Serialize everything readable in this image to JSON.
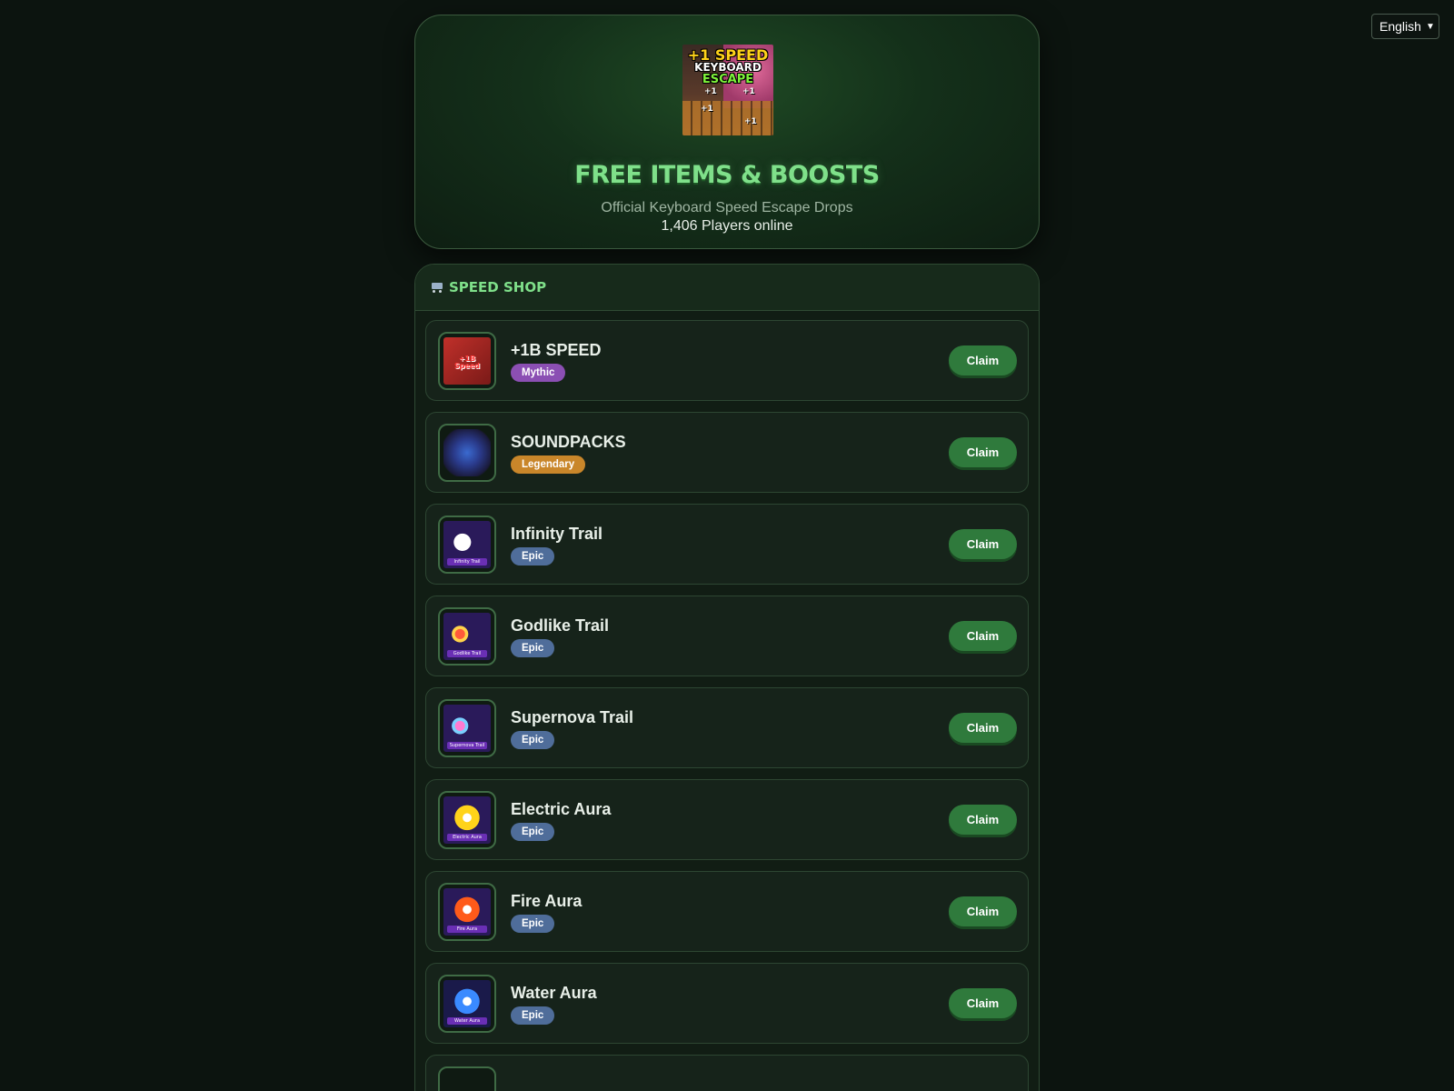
{
  "language": {
    "selected": "English"
  },
  "header": {
    "thumbnail": {
      "line1": "+1 SPEED",
      "line2": "KEYBOARD",
      "line3": "ESCAPE",
      "badge": "+1"
    },
    "title": "FREE ITEMS & BOOSTS",
    "subtitle": "Official Keyboard Speed Escape Drops",
    "online": "1,406 Players online"
  },
  "shop": {
    "title": "SPEED SHOP",
    "icon": "cart-icon",
    "items": [
      {
        "name": "+1B SPEED",
        "rarity": "Mythic",
        "rarity_color": "#8b4fb3",
        "icon": "red-shoe-speed-icon",
        "icon_label": "+1B Speed",
        "claim": "Claim"
      },
      {
        "name": "SOUNDPACKS",
        "rarity": "Legendary",
        "rarity_color": "#c9862a",
        "icon": "soundpacks-orb-icon",
        "icon_label": "",
        "claim": "Claim"
      },
      {
        "name": "Infinity Trail",
        "rarity": "Epic",
        "rarity_color": "#4f6d9a",
        "icon": "infinity-trail-icon",
        "icon_label": "Infinity Trail",
        "claim": "Claim"
      },
      {
        "name": "Godlike Trail",
        "rarity": "Epic",
        "rarity_color": "#4f6d9a",
        "icon": "godlike-trail-icon",
        "icon_label": "Godlike Trail",
        "claim": "Claim"
      },
      {
        "name": "Supernova Trail",
        "rarity": "Epic",
        "rarity_color": "#4f6d9a",
        "icon": "supernova-trail-icon",
        "icon_label": "Supernova Trail",
        "claim": "Claim"
      },
      {
        "name": "Electric Aura",
        "rarity": "Epic",
        "rarity_color": "#4f6d9a",
        "icon": "electric-aura-icon",
        "icon_label": "Electric Aura",
        "claim": "Claim"
      },
      {
        "name": "Fire Aura",
        "rarity": "Epic",
        "rarity_color": "#4f6d9a",
        "icon": "fire-aura-icon",
        "icon_label": "Fire Aura",
        "claim": "Claim"
      },
      {
        "name": "Water Aura",
        "rarity": "Epic",
        "rarity_color": "#4f6d9a",
        "icon": "water-aura-icon",
        "icon_label": "Water Aura",
        "claim": "Claim"
      }
    ]
  }
}
